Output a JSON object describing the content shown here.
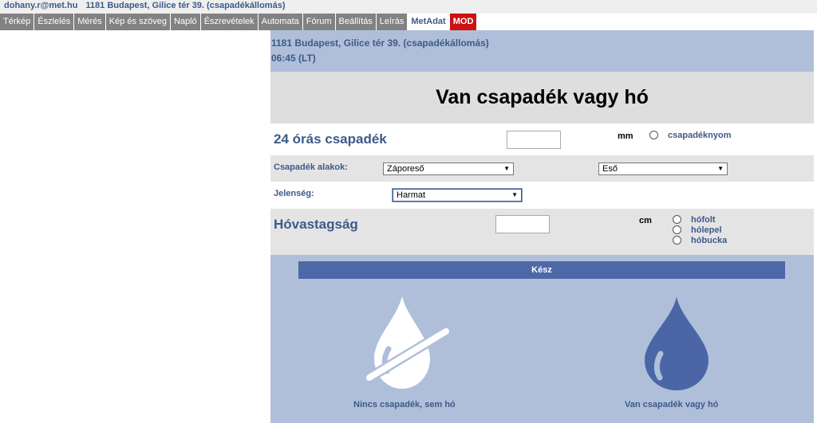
{
  "topbar": {
    "user": "dohany.r@met.hu",
    "station": "1181 Budapest, Gilice tér 39. (csapadékállomás)"
  },
  "nav": {
    "tabs": [
      {
        "label": "Térkép",
        "state": "normal"
      },
      {
        "label": "Észlelés",
        "state": "normal"
      },
      {
        "label": "Mérés",
        "state": "normal"
      },
      {
        "label": "Kép és szöveg",
        "state": "normal"
      },
      {
        "label": "Napló",
        "state": "normal"
      },
      {
        "label": "Észrevételek",
        "state": "normal"
      },
      {
        "label": "Automata",
        "state": "normal"
      },
      {
        "label": "Fórum",
        "state": "normal"
      },
      {
        "label": "Beállítás",
        "state": "normal"
      },
      {
        "label": "Leírás",
        "state": "normal"
      },
      {
        "label": "MetAdat",
        "state": "active"
      },
      {
        "label": "MOD",
        "state": "mod"
      }
    ]
  },
  "header": {
    "station": "1181 Budapest, Gilice tér 39. (csapadékállomás)",
    "time": "06:45 (LT)"
  },
  "status": {
    "title": "Van csapadék vagy hó"
  },
  "precip24": {
    "label": "24 órás csapadék",
    "value": "",
    "unit": "mm",
    "option": "csapadéknyom"
  },
  "forms": {
    "label": "Csapadék alakok:",
    "select1": "Záporeső",
    "select2": "Eső"
  },
  "phenomenon": {
    "label": "Jelenség:",
    "select": "Harmat"
  },
  "snow": {
    "label": "Hóvastagság",
    "value": "",
    "unit": "cm",
    "options": [
      "hófolt",
      "hólepel",
      "hóbucka"
    ]
  },
  "done_label": "Kész",
  "choices": {
    "none": "Nincs csapadék, sem hó",
    "yes": "Van csapadék vagy hó"
  },
  "colors": {
    "accent": "#3d5a8a",
    "button": "#4e67a6",
    "panel": "#b0bfd9",
    "drop_filled": "#4a66a7",
    "mod": "#cc1111"
  },
  "icons": {
    "no_drop": "crossed-drop-icon",
    "drop": "drop-icon"
  }
}
